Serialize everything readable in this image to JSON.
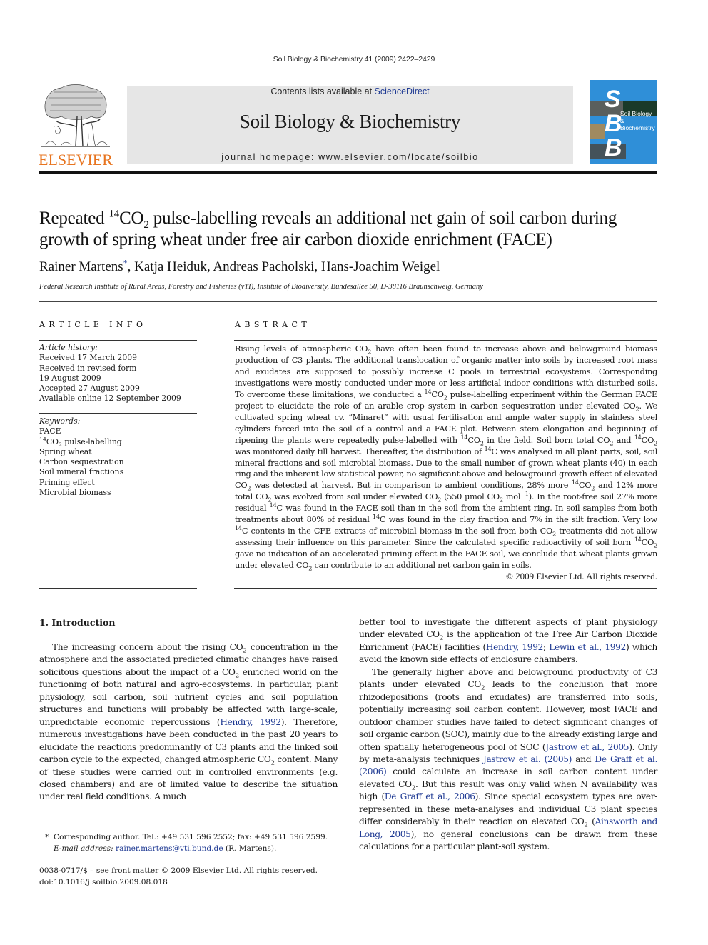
{
  "running_head": "Soil Biology & Biochemistry 41 (2009) 2422–2429",
  "publisher": {
    "name": "ELSEVIER",
    "logo_color": "#e7741f"
  },
  "banner": {
    "contents_prefix": "Contents lists available at ",
    "contents_link": "ScienceDirect",
    "journal_title": "Soil Biology & Biochemistry",
    "homepage": "journal homepage: www.elsevier.com/locate/soilbio",
    "background": "#e6e6e6",
    "link_color": "#1f3a93"
  },
  "cover": {
    "letters": [
      "S",
      "B",
      "B"
    ],
    "title_line1": "Soil Biology &",
    "title_line2": "Biochemistry",
    "color": "#2f8fd8"
  },
  "article": {
    "title_part1": "Repeated ",
    "title_sup": "14",
    "title_co": "CO",
    "title_sub": "2",
    "title_part2": " pulse-labelling reveals an additional net gain of soil carbon during growth of spring wheat under free air carbon dioxide enrichment (FACE)",
    "authors_first": "Rainer Martens",
    "authors_star": "*",
    "authors_rest": ", Katja Heiduk, Andreas Pacholski, Hans-Joachim Weigel",
    "affiliation": "Federal Research Institute of Rural Areas, Forestry and Fisheries (vTI), Institute of Biodiversity, Bundesallee 50, D-38116 Braunschweig, Germany"
  },
  "article_info": {
    "heading": "ARTICLE INFO",
    "history_label": "Article history:",
    "history": [
      "Received 17 March 2009",
      "Received in revised form",
      "19 August 2009",
      "Accepted 27 August 2009",
      "Available online 12 September 2009"
    ],
    "keywords_label": "Keywords:",
    "keywords": [
      "FACE",
      "14CO2 pulse-labelling",
      "Spring wheat",
      "Carbon sequestration",
      "Soil mineral fractions",
      "Priming effect",
      "Microbial biomass"
    ]
  },
  "abstract": {
    "heading": "ABSTRACT",
    "text": "Rising levels of atmospheric CO2 have often been found to increase above and belowground biomass production of C3 plants. The additional translocation of organic matter into soils by increased root mass and exudates are supposed to possibly increase C pools in terrestrial ecosystems. Corresponding investigations were mostly conducted under more or less artificial indoor conditions with disturbed soils. To overcome these limitations, we conducted a 14CO2 pulse-labelling experiment within the German FACE project to elucidate the role of an arable crop system in carbon sequestration under elevated CO2. We cultivated spring wheat cv. “Minaret” with usual fertilisation and ample water supply in stainless steel cylinders forced into the soil of a control and a FACE plot. Between stem elongation and beginning of ripening the plants were repeatedly pulse-labelled with 14CO2 in the field. Soil born total CO2 and 14CO2 was monitored daily till harvest. Thereafter, the distribution of 14C was analysed in all plant parts, soil, soil mineral fractions and soil microbial biomass. Due to the small number of grown wheat plants (40) in each ring and the inherent low statistical power, no significant above and belowground growth effect of elevated CO2 was detected at harvest. But in comparison to ambient conditions, 28% more 14CO2 and 12% more total CO2 was evolved from soil under elevated CO2 (550 µmol CO2 mol−1). In the root-free soil 27% more residual 14C was found in the FACE soil than in the soil from the ambient ring. In soil samples from both treatments about 80% of residual 14C was found in the clay fraction and 7% in the silt fraction. Very low 14C contents in the CFE extracts of microbial biomass in the soil from both CO2 treatments did not allow assessing their influence on this parameter. Since the calculated specific radioactivity of soil born 14CO2 gave no indication of an accelerated priming effect in the FACE soil, we conclude that wheat plants grown under elevated CO2 can contribute to an additional net carbon gain in soils.",
    "copyright": "© 2009 Elsevier Ltd. All rights reserved."
  },
  "introduction": {
    "heading": "1.  Introduction",
    "col1_p1": "The increasing concern about the rising CO2 concentration in the atmosphere and the associated predicted climatic changes have raised solicitous questions about the impact of a CO2 enriched world on the functioning of both natural and agro-ecosystems. In particular, plant physiology, soil carbon, soil nutrient cycles and soil population structures and functions will probably be affected with large-scale, unpredictable economic repercussions (Hendry, 1992). Therefore, numerous investigations have been conducted in the past 20 years to elucidate the reactions predominantly of C3 plants and the linked soil carbon cycle to the expected, changed atmospheric CO2 content. Many of these studies were carried out in controlled environments (e.g. closed chambers) and are of limited value to describe the situation under real field conditions. A much",
    "col2_p1": "better tool to investigate the different aspects of plant physiology under elevated CO2 is the application of the Free Air Carbon Dioxide Enrichment (FACE) facilities (Hendry, 1992; Lewin et al., 1992) which avoid the known side effects of enclosure chambers.",
    "col2_p2": "The generally higher above and belowground productivity of C3 plants under elevated CO2 leads to the conclusion that more rhizodepositions (roots and exudates) are transferred into soils, potentially increasing soil carbon content. However, most FACE and outdoor chamber studies have failed to detect significant changes of soil organic carbon (SOC), mainly due to the already existing large and often spatially heterogeneous pool of SOC (Jastrow et al., 2005). Only by meta-analysis techniques Jastrow et al. (2005) and De Graff et al. (2006) could calculate an increase in soil carbon content under elevated CO2. But this result was only valid when N availability was high (De Graff et al., 2006). Since special ecosystem types are over-represented in these meta-analyses and individual C3 plant species differ considerably in their reaction on elevated CO2 (Ainsworth and Long, 2005), no general conclusions can be drawn from these calculations for a particular plant-soil system."
  },
  "footnote": {
    "marker": "*",
    "corresponding": "Corresponding author. Tel.: +49 531 596 2552; fax: +49 531 596 2599.",
    "email_label": "E-mail address:",
    "email": "rainer.martens@vti.bund.de",
    "email_suffix": " (R. Martens)."
  },
  "front_matter": {
    "issn_line": "0038-0717/$ – see front matter © 2009 Elsevier Ltd. All rights reserved.",
    "doi": "doi:10.1016/j.soilbio.2009.08.018"
  }
}
